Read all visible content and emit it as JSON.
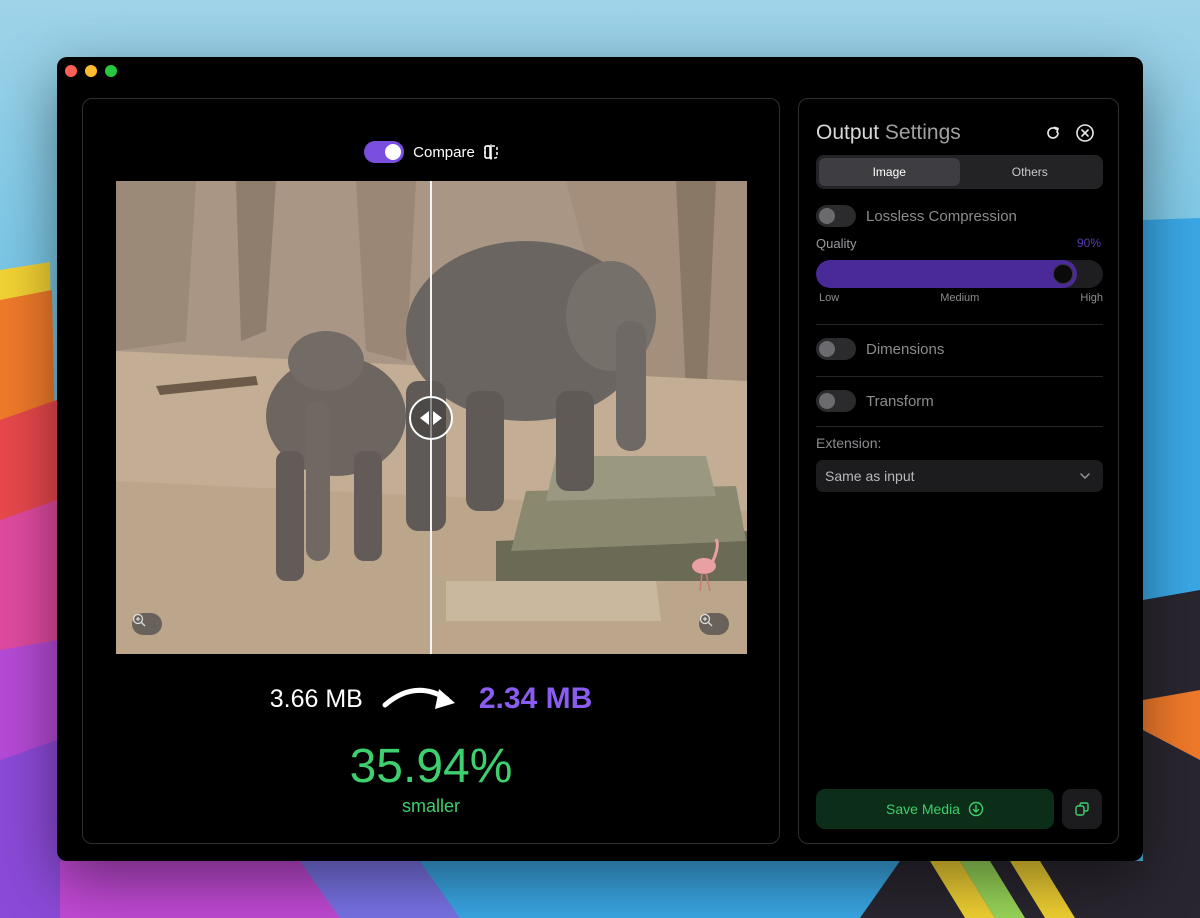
{
  "compare": {
    "label": "Compare",
    "enabled": true
  },
  "sizes": {
    "original": "3.66 MB",
    "compressed": "2.34 MB"
  },
  "reduction": {
    "percent": "35.94%",
    "caption": "smaller"
  },
  "settings": {
    "title_main": "Output",
    "title_rest": " Settings",
    "tabs": [
      "Image",
      "Others"
    ],
    "active_tab": "Image",
    "lossless": {
      "label": "Lossless Compression",
      "enabled": false
    },
    "quality": {
      "label": "Quality",
      "value_text": "90%",
      "value": 0.9,
      "ticks": [
        "Low",
        "Medium",
        "High"
      ]
    },
    "dimensions": {
      "label": "Dimensions",
      "enabled": false
    },
    "transform": {
      "label": "Transform",
      "enabled": false
    },
    "extension": {
      "label": "Extension:",
      "selected": "Same as input"
    },
    "save_label": "Save Media"
  },
  "icons": {
    "compare_mode": "split-view-icon",
    "reset": "refresh-icon",
    "close": "close-circle-icon",
    "zoom": "zoom-in-icon",
    "dropdown": "chevron-down-icon",
    "save": "download-circle-icon",
    "copy": "copy-icon"
  },
  "colors": {
    "accent": "#7a4fe0",
    "success": "#3ecf6e",
    "slider_fill": "#4a2a98"
  }
}
